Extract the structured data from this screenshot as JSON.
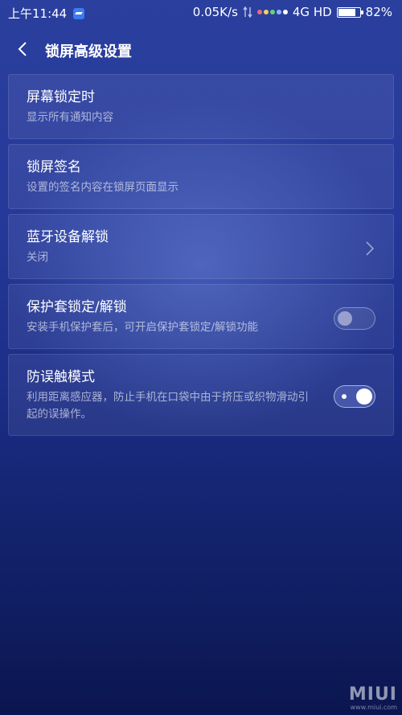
{
  "status_bar": {
    "time": "上午11:44",
    "net_speed": "0.05K/s",
    "network": "4G HD",
    "battery": "82%",
    "battery_level": 0.82
  },
  "header": {
    "title": "锁屏高级设置",
    "back_icon": "chevron-left-icon"
  },
  "settings": [
    {
      "title": "屏幕锁定时",
      "subtitle": "显示所有通知内容"
    },
    {
      "title": "锁屏签名",
      "subtitle": "设置的签名内容在锁屏页面显示"
    },
    {
      "title": "蓝牙设备解锁",
      "subtitle": "关闭",
      "control": "chevron-right-icon"
    },
    {
      "title": "保护套锁定/解锁",
      "subtitle": "安装手机保护套后，可开启保护套锁定/解锁功能",
      "toggle": false
    },
    {
      "title": "防误触模式",
      "subtitle": "利用距离感应器，防止手机在口袋中由于挤压或织物滑动引起的误操作。",
      "toggle": true
    }
  ],
  "watermark": {
    "logo": "MIUI",
    "sub": "www.miui.com"
  }
}
